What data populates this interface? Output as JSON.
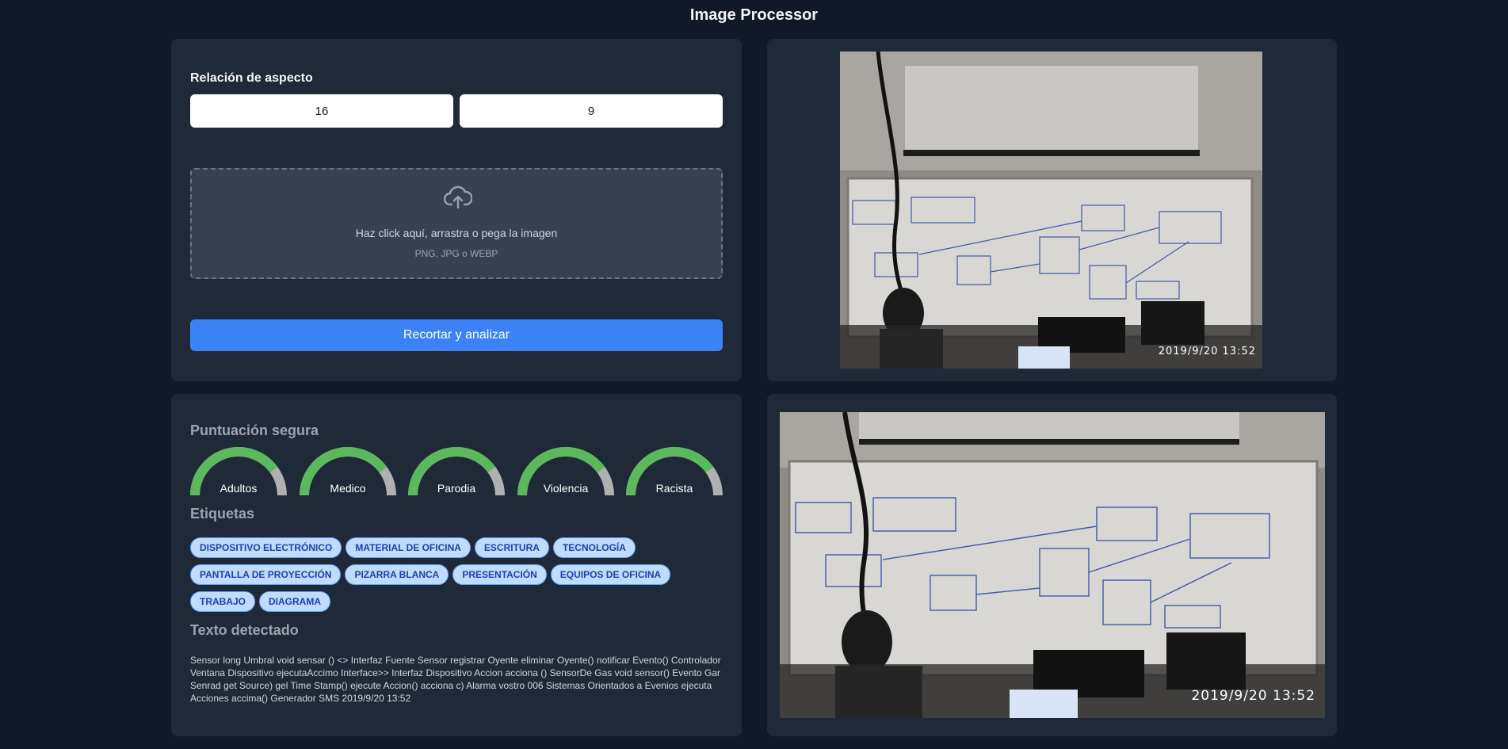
{
  "app": {
    "title": "Image Processor"
  },
  "controls": {
    "aspect_label": "Relación de aspecto",
    "ratio_width": "16",
    "ratio_height": "9",
    "dropzone": {
      "icon": "cloud-upload-icon",
      "main_text": "Haz click aquí, arrastra o pega la imagen",
      "sub_text": "PNG, JPG o WEBP"
    },
    "submit_label": "Recortar y analizar",
    "accent_color": "#3b82f6"
  },
  "analysis": {
    "score_heading": "Puntuación segura",
    "gauges": [
      {
        "label": "Adultos",
        "level": 0.8
      },
      {
        "label": "Medico",
        "level": 0.8
      },
      {
        "label": "Parodia",
        "level": 0.8
      },
      {
        "label": "Violencia",
        "level": 0.8
      },
      {
        "label": "Racista",
        "level": 0.8
      }
    ],
    "gauge_colors": {
      "fill": "#5cb85c",
      "track": "#b0b0b0"
    },
    "tags_heading": "Etiquetas",
    "tags": [
      [
        "DISPOSITIVO ELECTRÓNICO",
        "MATERIAL DE OFICINA",
        "ESCRITURA",
        "TECNOLOGÍA"
      ],
      [
        "PANTALLA DE PROYECCIÓN",
        "PIZARRA BLANCA",
        "PRESENTACIÓN",
        "EQUIPOS DE OFICINA"
      ],
      [
        "TRABAJO",
        "DIAGRAMA"
      ]
    ],
    "text_heading": "Texto detectado",
    "detected_text": "Sensor long Umbral void sensar () <> Interfaz Fuente Sensor registrar Oyente eliminar Oyente() notificar Evento() Controlador Ventana Dispositivo ejecutaAccimo Interface>> Interfaz Dispositivo Accion acciona () SensorDe Gas void sensor() Evento Gar Senrad get Source) gel Time Stamp() ejecute Accion() acciona c) Alarma vostro 006 Sistemas Orientados a Evenios ejecuta Acciones accima() Generador SMS 2019/9/20 13:52"
  },
  "preview": {
    "timestamp": "2019/9/20  13:52"
  },
  "result": {
    "timestamp": "2019/9/20  13:52"
  }
}
